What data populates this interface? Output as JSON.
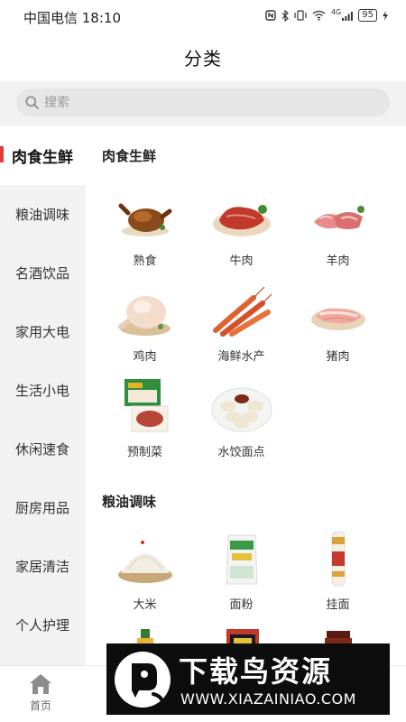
{
  "status_bar": {
    "carrier_time": "中国电信 18:10",
    "network": "4G",
    "battery": "95"
  },
  "header": {
    "title": "分类"
  },
  "search": {
    "placeholder": "搜索"
  },
  "sidebar": {
    "items": [
      {
        "label": "肉食生鲜",
        "active": true
      },
      {
        "label": "粮油调味"
      },
      {
        "label": "名酒饮品"
      },
      {
        "label": "家用大电"
      },
      {
        "label": "生活小电"
      },
      {
        "label": "休闲速食"
      },
      {
        "label": "厨房用品"
      },
      {
        "label": "家居清洁"
      },
      {
        "label": "个人护理"
      }
    ]
  },
  "sections": [
    {
      "title": "肉食生鲜",
      "items": [
        {
          "label": "熟食",
          "icon": "roast-chicken-icon"
        },
        {
          "label": "牛肉",
          "icon": "beef-icon"
        },
        {
          "label": "羊肉",
          "icon": "lamb-icon"
        },
        {
          "label": "鸡肉",
          "icon": "chicken-icon"
        },
        {
          "label": "海鲜水产",
          "icon": "shrimp-icon"
        },
        {
          "label": "猪肉",
          "icon": "pork-icon"
        },
        {
          "label": "预制菜",
          "icon": "prepared-dish-icon"
        },
        {
          "label": "水饺面点",
          "icon": "dumplings-icon"
        }
      ]
    },
    {
      "title": "粮油调味",
      "items": [
        {
          "label": "大米",
          "icon": "rice-icon"
        },
        {
          "label": "面粉",
          "icon": "flour-icon"
        },
        {
          "label": "挂面",
          "icon": "noodles-icon"
        }
      ]
    }
  ],
  "tabbar": {
    "items": [
      {
        "label": "首页",
        "icon": "home-icon"
      }
    ]
  },
  "watermark": {
    "title": "下载鸟资源",
    "url": "WWW.XIAZAINIAO.COM"
  },
  "colors": {
    "accent": "#e53935",
    "sidebar_bg": "#f2f2f2",
    "tab_icon": "#8c8c8c"
  }
}
